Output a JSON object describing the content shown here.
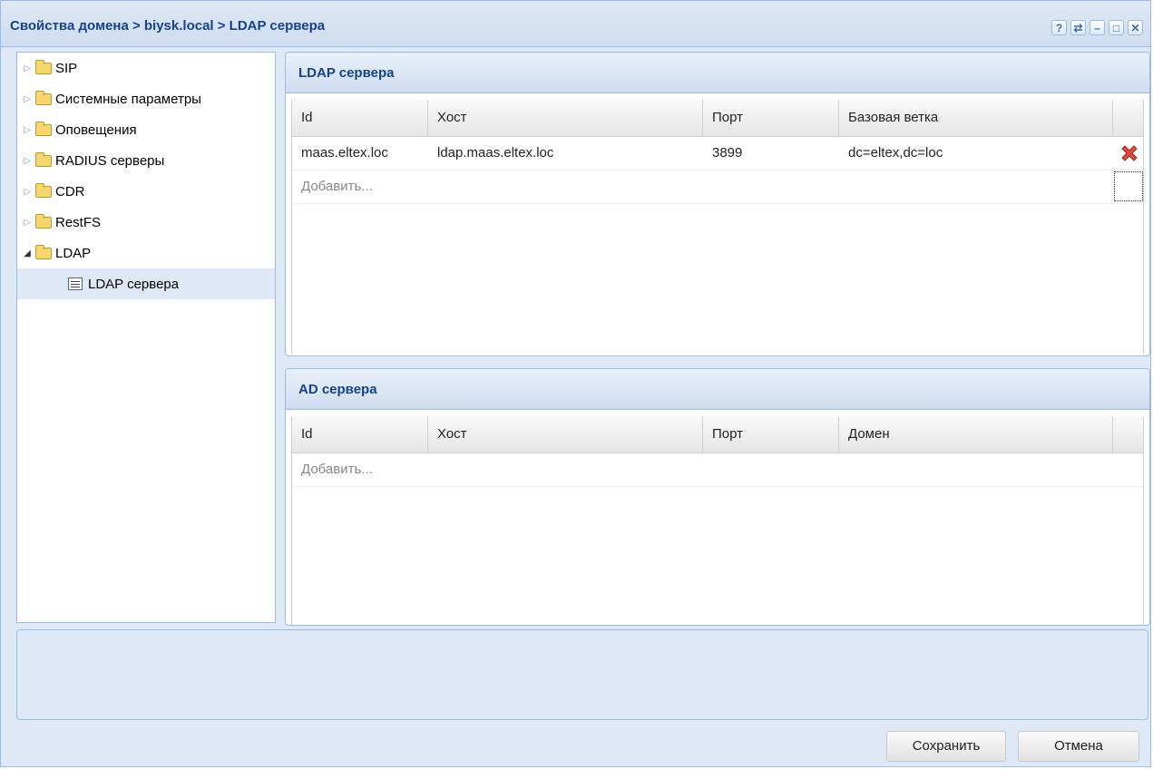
{
  "window": {
    "title": "Свойства домена > biysk.local > LDAP сервера",
    "tools": [
      "?",
      "⇄",
      "–",
      "□",
      "✕"
    ]
  },
  "tree": {
    "items": [
      {
        "label": "SIP",
        "expanded": false
      },
      {
        "label": "Системные параметры",
        "expanded": false
      },
      {
        "label": "Оповещения",
        "expanded": false
      },
      {
        "label": "RADIUS серверы",
        "expanded": false
      },
      {
        "label": "CDR",
        "expanded": false
      },
      {
        "label": "RestFS",
        "expanded": false
      },
      {
        "label": "LDAP",
        "expanded": true
      }
    ],
    "child": {
      "label": "LDAP сервера",
      "selected": true
    }
  },
  "ldap": {
    "title": "LDAP сервера",
    "columns": [
      "Id",
      "Хост",
      "Порт",
      "Базовая ветка"
    ],
    "rows": [
      {
        "id": "maas.eltex.loc",
        "host": "ldap.maas.eltex.loc",
        "port": "3899",
        "base": "dc=eltex,dc=loc"
      }
    ],
    "add_label": "Добавить..."
  },
  "ad": {
    "title": "AD сервера",
    "columns": [
      "Id",
      "Хост",
      "Порт",
      "Домен"
    ],
    "add_label": "Добавить..."
  },
  "buttons": {
    "save": "Сохранить",
    "cancel": "Отмена"
  }
}
